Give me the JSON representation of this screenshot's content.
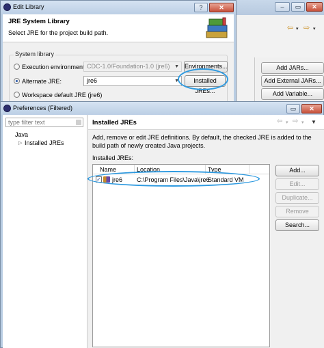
{
  "edit_library": {
    "window_title": "Edit Library",
    "header_title": "JRE System Library",
    "header_description": "Select JRE for the project build path.",
    "group_label": "System library",
    "exec_env_label": "Execution environment:",
    "exec_env_value": "CDC-1.0/Foundation-1.0 (jre6)",
    "environments_button": "Environments...",
    "alternate_jre_label": "Alternate JRE:",
    "alternate_jre_value": "jre6",
    "installed_jres_button": "Installed JREs...",
    "workspace_default_label": "Workspace default JRE (jre6)"
  },
  "background_window": {
    "buttons": [
      "Add JARs...",
      "Add External JARs...",
      "Add Variable..."
    ]
  },
  "preferences": {
    "window_title": "Preferences (Filtered)",
    "filter_placeholder": "type filter text",
    "tree": [
      {
        "label": "Java"
      },
      {
        "label": "Installed JREs"
      }
    ],
    "page_title": "Installed JREs",
    "description": "Add, remove or edit JRE definitions. By default, the checked JRE is added to the build path of newly created Java projects.",
    "list_label": "Installed JREs:",
    "columns": [
      "Name",
      "Location",
      "Type"
    ],
    "rows": [
      {
        "name": "jre6",
        "location": "C:\\Program Files\\Java\\jre6",
        "type": "Standard VM",
        "checked": true
      }
    ],
    "buttons": {
      "add": "Add...",
      "edit": "Edit...",
      "duplicate": "Duplicate...",
      "remove": "Remove",
      "search": "Search..."
    }
  },
  "colors": {
    "annotation": "#2e9ae0",
    "titlebar": "#bccfe5"
  }
}
